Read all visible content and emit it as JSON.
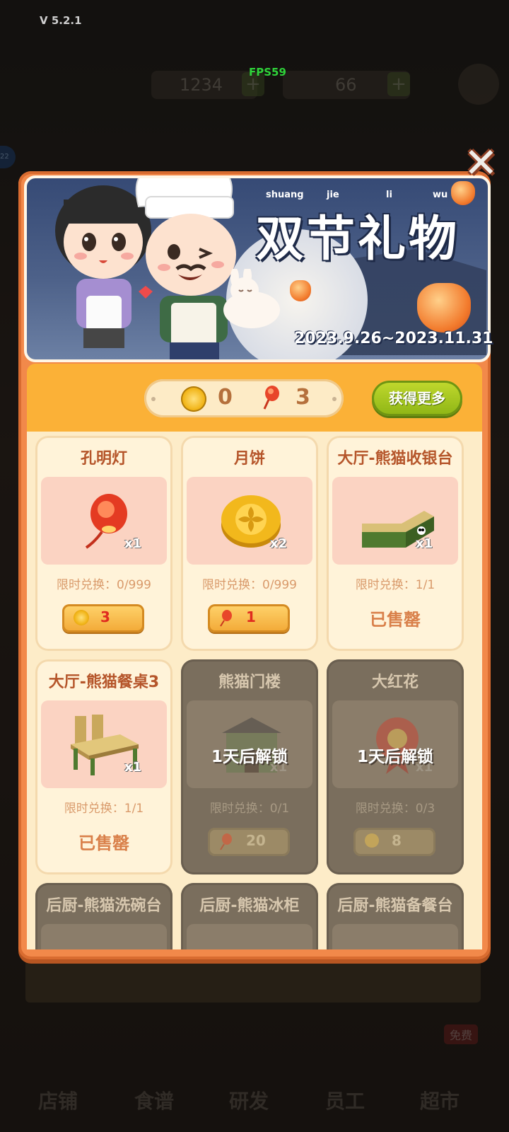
{
  "app": {
    "version": "V 5.2.1",
    "fps": "FPS59"
  },
  "background": {
    "resource_1": "1234",
    "resource_2": "66",
    "plus_symbol": "+",
    "badge": "22",
    "free_label": "免费",
    "tabs": [
      "店铺",
      "食谱",
      "研发",
      "员工",
      "超市"
    ]
  },
  "modal": {
    "close_symbol": "✕",
    "banner": {
      "pinyin": [
        "shuang",
        "jie",
        "li",
        "wu"
      ],
      "title": "双节礼物",
      "date_range": "2023.9.26~2023.11.31"
    },
    "currency": {
      "mooncake_count": "0",
      "lantern_count": "3",
      "get_more_label": "获得更多"
    },
    "items": [
      {
        "name": "孔明灯",
        "qty": "x1",
        "limit": "限时兑换：0/999",
        "price": "3",
        "price_currency": "mooncake",
        "state": "available",
        "icon": "sky-lantern-icon"
      },
      {
        "name": "月饼",
        "qty": "x2",
        "limit": "限时兑换：0/999",
        "price": "1",
        "price_currency": "lantern",
        "state": "available",
        "icon": "mooncake-icon"
      },
      {
        "name": "大厅-熊猫收银台",
        "qty": "x1",
        "limit": "限时兑换：1/1",
        "soldout": "已售罄",
        "state": "soldout",
        "icon": "panda-cashier-counter-icon"
      },
      {
        "name": "大厅-熊猫餐桌3",
        "qty": "x1",
        "limit": "限时兑换：1/1",
        "soldout": "已售罄",
        "state": "soldout",
        "icon": "panda-dining-table-icon"
      },
      {
        "name": "熊猫门楼",
        "qty": "x1",
        "limit": "限时兑换：0/1",
        "price": "20",
        "price_currency": "lantern",
        "unlock": "1天后解锁",
        "state": "locked",
        "icon": "panda-gate-building-icon"
      },
      {
        "name": "大红花",
        "qty": "x1",
        "limit": "限时兑换：0/3",
        "price": "8",
        "price_currency": "mooncake",
        "unlock": "1天后解锁",
        "state": "locked",
        "icon": "red-flower-icon"
      },
      {
        "name": "后厨-熊猫洗碗台",
        "state": "locked"
      },
      {
        "name": "后厨-熊猫冰柜",
        "state": "locked"
      },
      {
        "name": "后厨-熊猫备餐台",
        "state": "locked"
      }
    ]
  },
  "colors": {
    "modal_orange": "#f2894a",
    "panel_yellow": "#fbb137",
    "card_cream": "#fff3d9",
    "title_brown": "#b5552a",
    "price_red": "#e02b1f",
    "button_green": "#8db515"
  }
}
